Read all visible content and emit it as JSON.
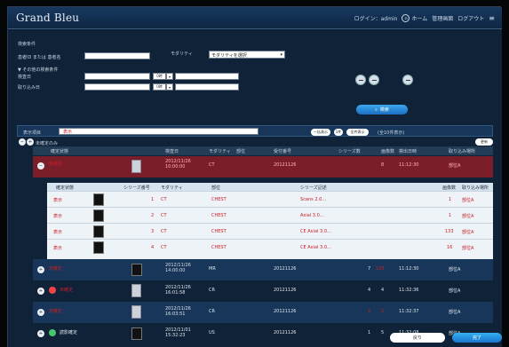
{
  "app": {
    "brand": "Grand Bleu"
  },
  "header": {
    "links": [
      "ログイン：admin",
      "ホーム",
      "管理画面",
      "ログアウト"
    ],
    "menu_icon": "hamburger-icon"
  },
  "search": {
    "title": "検索条件",
    "name_label": "患者ID または 患者名",
    "modality_label": "モダリティ",
    "modality_selected": "モダリティを選択",
    "other_label": "▼ その他の検索条件",
    "date_label": "検査日",
    "received_label": "取り込み日",
    "button": "検索"
  },
  "saved": {
    "label": "表示項目",
    "status_text": "表示",
    "btn_all": "一括表示",
    "btn_count": "1件",
    "btn_filter": "全件表示",
    "count_text": "(全10件表示)"
  },
  "list": {
    "toggle_label": "未確定のみ",
    "action": "更新",
    "headers": [
      "確定状態",
      "検査日",
      "モダリティ",
      "部位",
      "受付番号",
      "シリーズ数",
      "画像数",
      "検出日時",
      "取り込み場所"
    ]
  },
  "rows": [
    {
      "state": "未確定",
      "date": "2012/11/26 10:00:00",
      "modality": "CT",
      "part": "",
      "accession": "20121126",
      "series": "",
      "images": "8",
      "detect": "11:12:30",
      "place": "部位A"
    },
    {
      "state": "未確定",
      "date": "2012/11/26 14:00:00",
      "modality": "MR",
      "part": "",
      "accession": "20121126",
      "series": "7",
      "images": "126",
      "detect": "11:12:30",
      "place": "部位A"
    },
    {
      "state": "未確定",
      "date": "2012/11/26 16:01:58",
      "modality": "CR",
      "part": "",
      "accession": "20121126",
      "series": "4",
      "images": "4",
      "detect": "11:32:36",
      "place": "部位A"
    },
    {
      "state": "未確定",
      "date": "2012/11/26 16:03:51",
      "modality": "CR",
      "part": "",
      "accession": "20121126",
      "series": "2",
      "images": "2",
      "detect": "11:32:37",
      "place": "部位A"
    },
    {
      "state": "読影確定",
      "date": "2012/11/01 15:32:23",
      "modality": "US",
      "part": "",
      "accession": "20121126",
      "series": "1",
      "images": "5",
      "detect": "11:32:08",
      "place": "部位A"
    }
  ],
  "series_table": {
    "headers": [
      "確定状態",
      "シリーズ番号",
      "モダリティ",
      "部位",
      "シリーズ記述",
      "画像数",
      "取り込み場所"
    ],
    "rows": [
      {
        "state": "表示",
        "num": "1",
        "modality": "CT",
        "part": "CHEST",
        "desc": "Scans 2.0...",
        "count": "1",
        "place": "部位A"
      },
      {
        "state": "表示",
        "num": "2",
        "modality": "CT",
        "part": "CHEST",
        "desc": "Axial 3.0...",
        "count": "1",
        "place": "部位A"
      },
      {
        "state": "表示",
        "num": "3",
        "modality": "CT",
        "part": "CHEST",
        "desc": "CE Axial 3.0...",
        "count": "133",
        "place": "部位A"
      },
      {
        "state": "表示",
        "num": "4",
        "modality": "CT",
        "part": "CHEST",
        "desc": "CE Axial 3.0...",
        "count": "16",
        "place": "部位A"
      }
    ]
  },
  "footer": {
    "back": "戻り",
    "done": "完了"
  }
}
